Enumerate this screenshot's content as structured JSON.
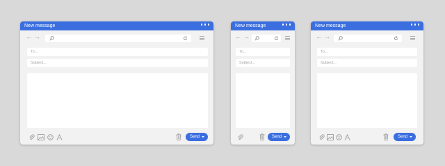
{
  "windows": [
    {
      "title": "New message",
      "to_placeholder": "To...",
      "subject_placeholder": "Subject...",
      "send_label": "Send"
    },
    {
      "title": "New message",
      "to_placeholder": "To...",
      "subject_placeholder": "Subject...",
      "send_label": "Send"
    },
    {
      "title": "New message",
      "to_placeholder": "To...",
      "subject_placeholder": "Subject...",
      "send_label": "Send"
    }
  ],
  "icons": {
    "back": "arrow-left-icon",
    "forward": "arrow-right-icon",
    "search": "search-icon",
    "reload": "reload-icon",
    "menu": "hamburger-menu-icon",
    "more": "more-dots-icon",
    "attach": "paperclip-icon",
    "image": "image-icon",
    "emoji": "emoji-icon",
    "font": "font-icon",
    "trash": "trash-icon",
    "send_caret": "caret-down-icon"
  },
  "colors": {
    "accent": "#3b6fe0",
    "background": "#d9d9d9",
    "window": "#f2f2f2",
    "field": "#ffffff"
  }
}
